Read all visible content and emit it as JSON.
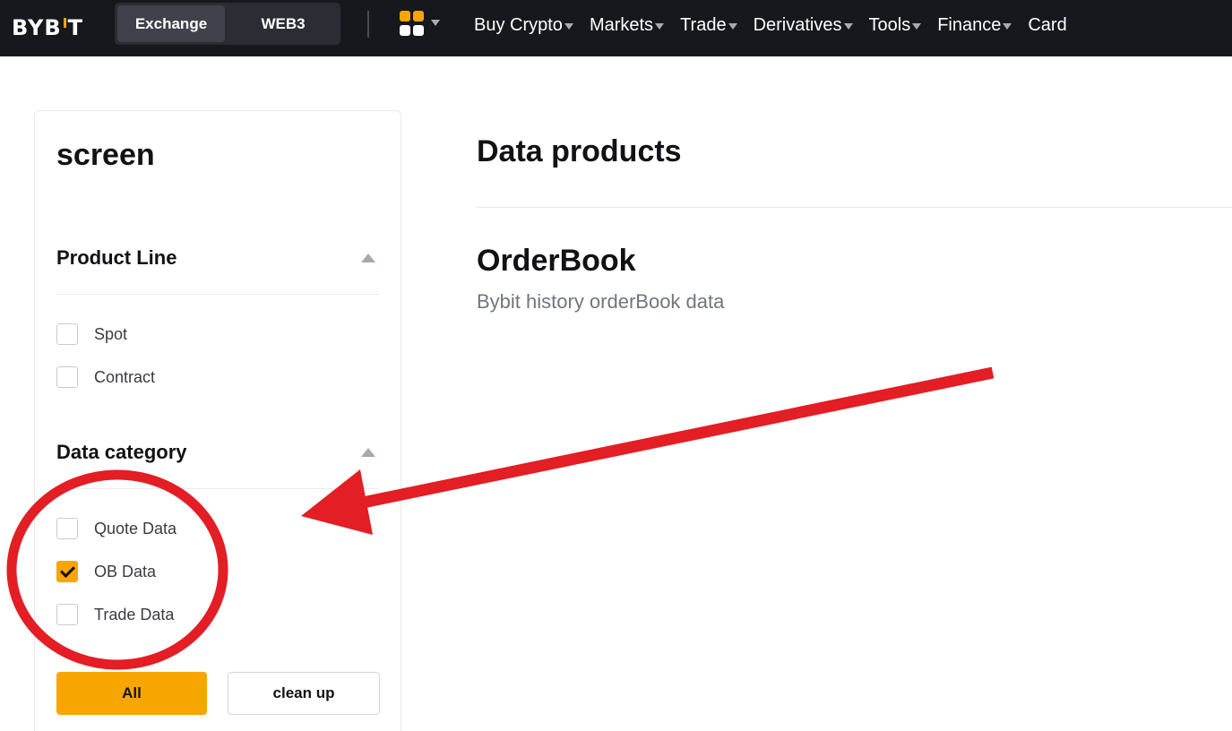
{
  "header": {
    "logo_text": "BYBIT",
    "logo_left": "BYB",
    "logo_right": "T",
    "switcher": {
      "exchange": "Exchange",
      "web3": "WEB3"
    },
    "nav": [
      {
        "label": "Buy Crypto",
        "has_dropdown": true
      },
      {
        "label": "Markets",
        "has_dropdown": true
      },
      {
        "label": "Trade",
        "has_dropdown": true
      },
      {
        "label": "Derivatives",
        "has_dropdown": true
      },
      {
        "label": "Tools",
        "has_dropdown": true
      },
      {
        "label": "Finance",
        "has_dropdown": true
      },
      {
        "label": "Card",
        "has_dropdown": false
      }
    ]
  },
  "sidebar": {
    "title": "screen",
    "product_line": {
      "label": "Product Line",
      "options": [
        {
          "label": "Spot",
          "checked": false
        },
        {
          "label": "Contract",
          "checked": false
        }
      ]
    },
    "data_category": {
      "label": "Data category",
      "options": [
        {
          "label": "Quote Data",
          "checked": false
        },
        {
          "label": "OB Data",
          "checked": true
        },
        {
          "label": "Trade Data",
          "checked": false
        }
      ]
    },
    "all_button": "All",
    "clean_button": "clean up"
  },
  "main": {
    "title": "Data products",
    "products": [
      {
        "title": "OrderBook",
        "description": "Bybit history orderBook data"
      }
    ]
  },
  "colors": {
    "accent": "#f7a600",
    "topbar_bg": "#17181e",
    "annotation_red": "#e31e24"
  },
  "icons": {
    "apps": "apps-grid-icon",
    "expand": "triangle-up-icon",
    "dropdown": "caret-down-icon"
  }
}
